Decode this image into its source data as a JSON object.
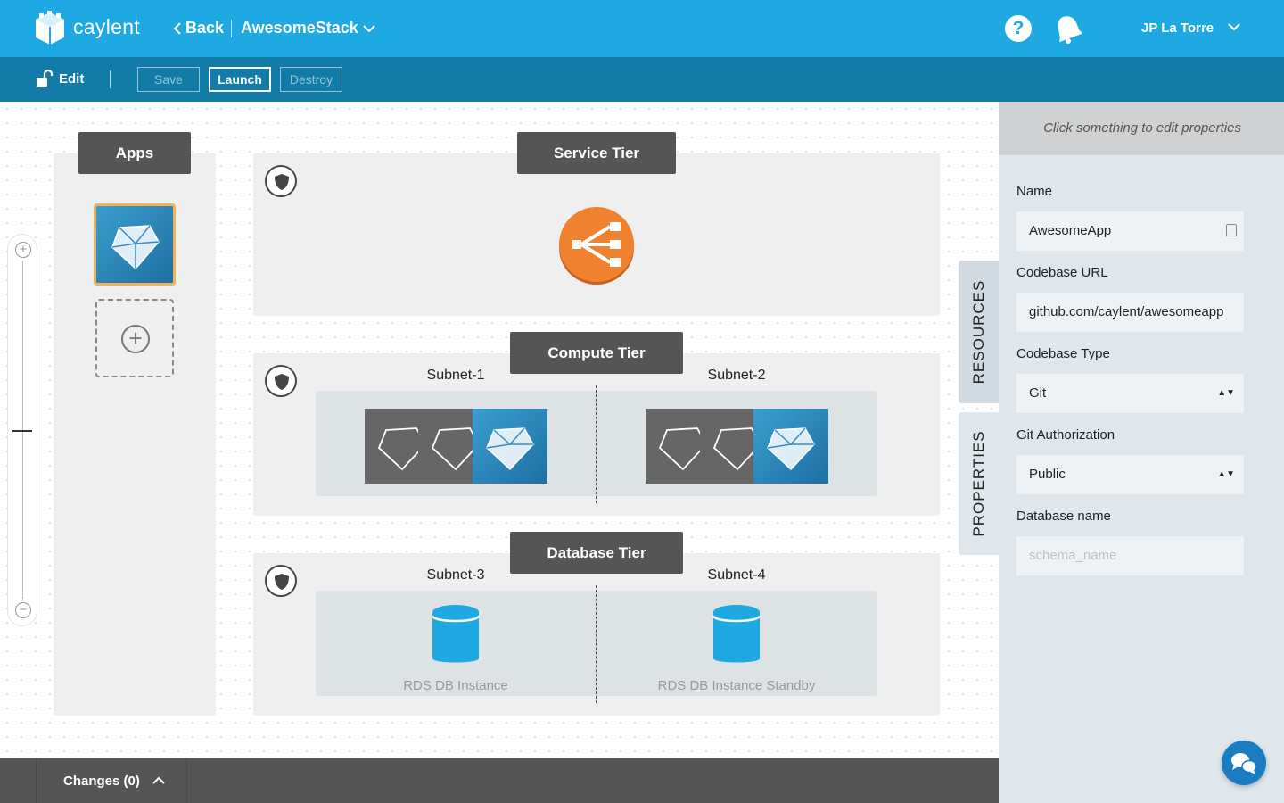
{
  "header": {
    "brand": "caylent",
    "back_label": "Back",
    "stack_name": "AwesomeStack",
    "user_name": "JP La Torre",
    "help_glyph": "?"
  },
  "toolbar": {
    "edit_label": "Edit",
    "save_label": "Save",
    "launch_label": "Launch",
    "destroy_label": "Destroy"
  },
  "canvas": {
    "apps_title": "Apps",
    "add_app_glyph": "+",
    "service_tier": "Service Tier",
    "compute_tier": "Compute Tier",
    "database_tier": "Database Tier",
    "subnets": [
      "Subnet-1",
      "Subnet-2",
      "Subnet-3",
      "Subnet-4"
    ],
    "db_instances": [
      "RDS DB Instance",
      "RDS DB Instance Standby"
    ],
    "zoom_plus": "+",
    "zoom_minus": "−"
  },
  "bottom": {
    "changes_label": "Changes (0)"
  },
  "side_tabs": {
    "resources": "RESOURCES",
    "properties": "PROPERTIES"
  },
  "properties": {
    "hint": "Click something to edit properties",
    "name_label": "Name",
    "name_value": "AwesomeApp",
    "codebase_url_label": "Codebase URL",
    "codebase_url_value": "github.com/caylent/awesomeapp",
    "codebase_type_label": "Codebase Type",
    "codebase_type_value": "Git",
    "git_auth_label": "Git Authorization",
    "git_auth_value": "Public",
    "db_name_label": "Database name",
    "db_name_placeholder": "schema_name"
  },
  "colors": {
    "header_blue": "#1ea9e2",
    "toolbar_blue": "#127ba8",
    "tag_grey": "#555555",
    "app_tile_blue": "#2a86bd",
    "load_balancer_orange": "#f0812f",
    "db_cyan": "#1ea9e2",
    "selection_orange": "#f0b458"
  },
  "icons": {
    "logo": "caylent-cube-icon",
    "back": "chevron-left-icon",
    "stack_dropdown": "chevron-down-icon",
    "help": "help-icon",
    "notifications": "bell-icon",
    "edit": "unlock-icon",
    "security_group": "shield-icon",
    "load_balancer": "load-balancer-icon",
    "app": "ruby-gem-icon",
    "database": "database-icon",
    "chat": "chat-icon"
  }
}
